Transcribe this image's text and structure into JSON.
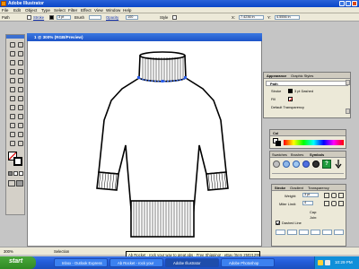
{
  "app": {
    "title": "Adobe Illustrator"
  },
  "menu": [
    "File",
    "Edit",
    "Object",
    "Type",
    "Select",
    "Filter",
    "Effect",
    "View",
    "Window",
    "Help"
  ],
  "control": {
    "selection_label": "Path",
    "fill_label": "Fill",
    "stroke_label": "Stroke",
    "stroke_weight": "3 pt",
    "brush_label": "Brush",
    "opacity_label": "Opacity",
    "opacity_value": "100",
    "style_label": "Style",
    "x_value": "7.4236 in",
    "y_value": "4.5556 in"
  },
  "document": {
    "title": "1 @ 300% (RGB/Preview)"
  },
  "appearance_panel": {
    "tabs": [
      "Appearance",
      "Graphic Styles"
    ],
    "header": "Path",
    "rows": [
      {
        "label": "Stroke",
        "value": "3 pt Dashed"
      },
      {
        "label": "Fill",
        "value": ""
      },
      {
        "label": "Default Transparency",
        "value": ""
      }
    ]
  },
  "color_panel": {
    "tabs": [
      "Col"
    ]
  },
  "swatches_panel": {
    "tabs": [
      "Swatches",
      "Brushes",
      "Symbols"
    ]
  },
  "stroke_panel": {
    "tabs": [
      "Stroke",
      "Gradient",
      "Transparency"
    ],
    "weight_label": "Weight:",
    "weight_value": "3 pt",
    "miter_label": "Miter Limit:",
    "miter_value": "4",
    "cap_label": "Cap:",
    "join_label": "Join:",
    "dashed_label": "Dashed Line"
  },
  "status": {
    "zoom": "300%",
    "tool": "Selection"
  },
  "tooltip": "Ab Rocket - rock your way to great abs - Free Shipping! - eBay (Item 250212993)",
  "taskbar": {
    "start": "start",
    "items": [
      "Inbox - Outlook Express",
      "Ab Rocket - rock your",
      "Adobe Illustrator",
      "Adobe Photoshop"
    ],
    "active_index": 2,
    "clock": "10:29 PM"
  },
  "colors": {
    "taskbar": "#245edb",
    "start": "#3c9a2e",
    "tooltip_bg": "#ffffe1",
    "doc_bg": "#ffffff"
  }
}
